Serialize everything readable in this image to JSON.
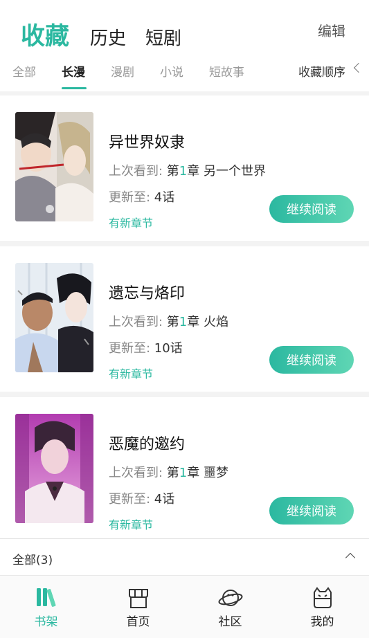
{
  "header": {
    "tabs": [
      {
        "label": "收藏"
      },
      {
        "label": "历史"
      },
      {
        "label": "短剧"
      }
    ],
    "edit_label": "编辑"
  },
  "sub_tabs": {
    "items": [
      {
        "label": "全部"
      },
      {
        "label": "长漫"
      },
      {
        "label": "漫剧"
      },
      {
        "label": "小说"
      },
      {
        "label": "短故事"
      }
    ],
    "active": "长漫",
    "sort_label": "收藏顺序"
  },
  "items": [
    {
      "title": "异世界奴隶",
      "last_read_prefix": "上次看到: ",
      "last_read_chapter_pre": "第",
      "last_read_chapter_num": "1",
      "last_read_chapter_post": "章 另一个世界",
      "update_prefix": "更新至: ",
      "update_value": "4话",
      "new_label": "有新章节",
      "button_label": "继续阅读"
    },
    {
      "title": "遗忘与烙印",
      "last_read_prefix": "上次看到: ",
      "last_read_chapter_pre": "第",
      "last_read_chapter_num": "1",
      "last_read_chapter_post": "章 火焰",
      "update_prefix": "更新至: ",
      "update_value": "10话",
      "new_label": "有新章节",
      "button_label": "继续阅读"
    },
    {
      "title": "恶魔的邀约",
      "last_read_prefix": "上次看到: ",
      "last_read_chapter_pre": "第",
      "last_read_chapter_num": "1",
      "last_read_chapter_post": "章 噩梦",
      "update_prefix": "更新至: ",
      "update_value": "4话",
      "new_label": "有新章节",
      "button_label": "继续阅读"
    }
  ],
  "filter": {
    "label": "全部(3)"
  },
  "bottom_nav": [
    {
      "label": "书架",
      "icon": "bookshelf-icon",
      "active": true
    },
    {
      "label": "首页",
      "icon": "store-icon"
    },
    {
      "label": "社区",
      "icon": "planet-icon"
    },
    {
      "label": "我的",
      "icon": "cat-face-icon"
    }
  ],
  "colors": {
    "accent": "#2bb8a0",
    "accent_light": "#5fd6b4"
  }
}
